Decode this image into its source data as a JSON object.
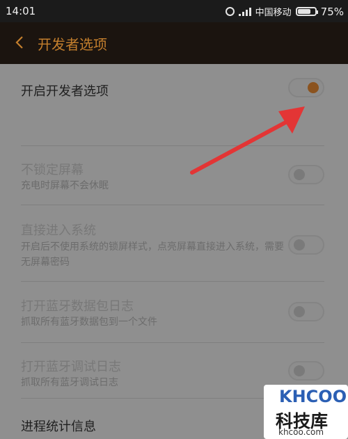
{
  "status_bar": {
    "time": "14:01",
    "carrier": "中国移动",
    "battery_percent": "75%",
    "battery_level": 0.75,
    "icons": [
      "alarm-icon",
      "signal-icon",
      "battery-icon"
    ]
  },
  "header": {
    "title": "开发者选项",
    "back_icon": "chevron-left-icon",
    "accent_color": "#c47f2d"
  },
  "settings": [
    {
      "title": "开启开发者选项",
      "subtitle": "",
      "enabled": true,
      "toggle_on": true
    },
    {
      "title": "不锁定屏幕",
      "subtitle": "充电时屏幕不会休眠",
      "enabled": false,
      "toggle_on": false
    },
    {
      "title": "直接进入系统",
      "subtitle": "开启后不使用系统的锁屏样式，点亮屏幕直接进入系统，需要无屏幕密码",
      "enabled": false,
      "toggle_on": false
    },
    {
      "title": "打开蓝牙数据包日志",
      "subtitle": "抓取所有蓝牙数据包到一个文件",
      "enabled": false,
      "toggle_on": false
    },
    {
      "title": "打开蓝牙调试日志",
      "subtitle": "抓取所有蓝牙调试日志",
      "enabled": false,
      "toggle_on": false
    },
    {
      "title": "进程统计信息",
      "subtitle": "",
      "enabled": true,
      "toggle_on": null
    }
  ],
  "watermark": {
    "brand": "KHCOO",
    "name_cn": "科技库",
    "url": "khcoo.com"
  }
}
